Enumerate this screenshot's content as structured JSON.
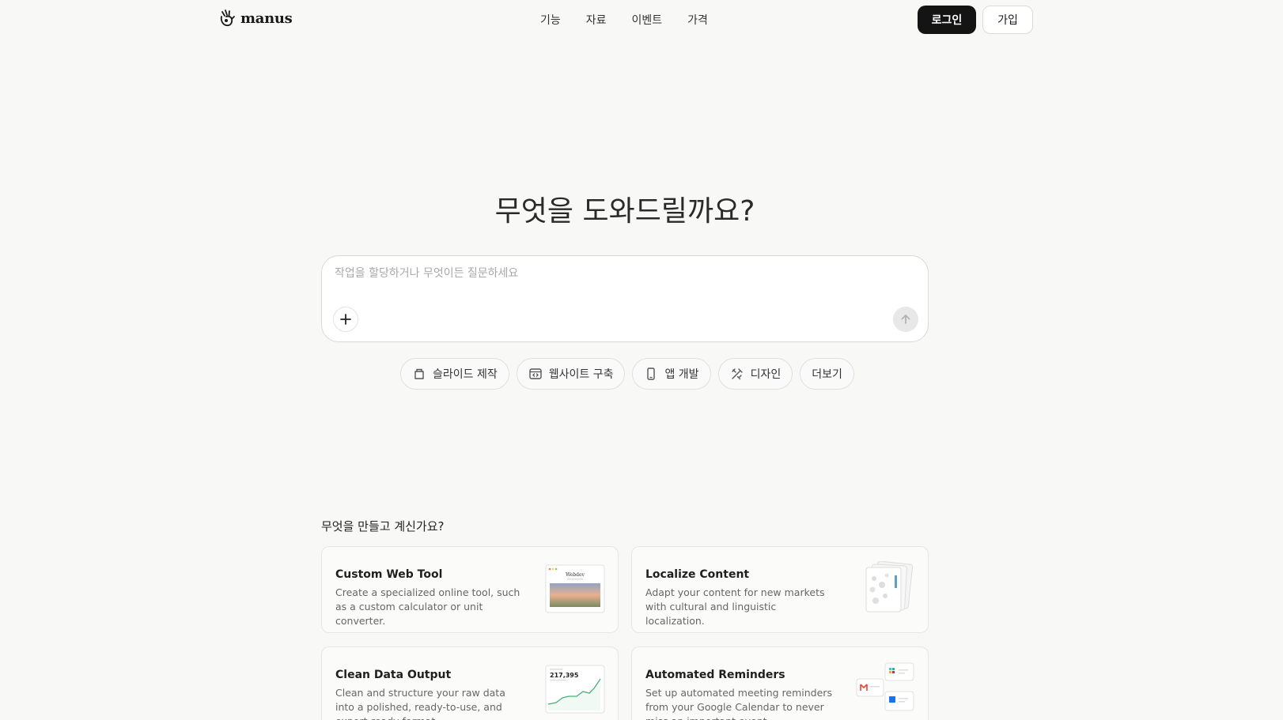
{
  "header": {
    "logo_text": "manus",
    "nav": [
      "기능",
      "자료",
      "이벤트",
      "가격"
    ],
    "login_label": "로그인",
    "signup_label": "가입"
  },
  "hero": {
    "title": "무엇을 도와드릴까요?",
    "input_placeholder": "작업을 할당하거나 무엇이든 질문하세요",
    "input_value": ""
  },
  "chips": [
    {
      "label": "슬라이드 제작",
      "icon": "slides-icon"
    },
    {
      "label": "웹사이트 구축",
      "icon": "website-icon"
    },
    {
      "label": "앱 개발",
      "icon": "phone-icon"
    },
    {
      "label": "디자인",
      "icon": "design-icon"
    },
    {
      "label": "더보기",
      "icon": ""
    }
  ],
  "section": {
    "title": "무엇을 만들고 계신가요?",
    "cards": [
      {
        "title": "Custom Web Tool",
        "desc": "Create a specialized online tool, such as a custom calculator or unit converter.",
        "thumb_text": "Webdev"
      },
      {
        "title": "Localize Content",
        "desc": "Adapt your content for new markets with cultural and linguistic localization."
      },
      {
        "title": "Clean Data Output",
        "desc": "Clean and structure your raw data into a polished, ready-to-use, and export-ready format.",
        "thumb_text": "217,395"
      },
      {
        "title": "Automated Reminders",
        "desc": "Set up automated meeting reminders from your Google Calendar to never miss an important event."
      }
    ]
  },
  "colors": {
    "background": "#f8f8f7",
    "primary_button": "#141414",
    "text": "#1a1a1a",
    "muted_text": "#666666"
  }
}
